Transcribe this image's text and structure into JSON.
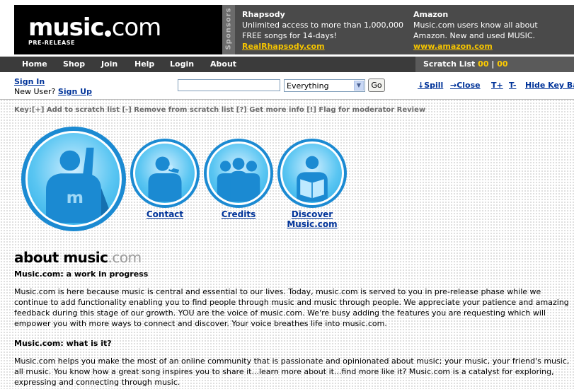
{
  "header": {
    "logo_word": "music",
    "logo_ext": "com",
    "logo_tag": "PRE-RELEASE",
    "sponsors_label": "Sponsors",
    "ads": [
      {
        "title": "Rhapsody",
        "text": "Unlimited access to more than 1,000,000 FREE songs for 14-days!",
        "link": "RealRhapsody.com"
      },
      {
        "title": "Amazon",
        "text": "Music.com users know all about Amazon. New and used MUSIC.",
        "link": "www.amazon.com"
      }
    ]
  },
  "nav": {
    "items": [
      "Home",
      "Shop",
      "Join",
      "Help",
      "Login",
      "About"
    ],
    "scratch_label": "Scratch List",
    "scratch_count_a": "00",
    "scratch_sep": "|",
    "scratch_count_b": "00"
  },
  "subbar": {
    "signin": "Sign In",
    "new_user": "New User?",
    "signup": "Sign Up",
    "search_value": "",
    "scope": "Everything",
    "go": "Go",
    "spill": "↓Spill",
    "close": "→Close",
    "tplus": "T+",
    "tminus": "T-",
    "hide_key": "Hide Key Bar"
  },
  "keybar": "Key:[+] Add to scratch list   [-] Remove from scratch list   [?] Get more info   [!] Flag for moderator Review",
  "icons": {
    "contact": "Contact",
    "credits": "Credits",
    "discover": "Discover Music.com"
  },
  "colors": {
    "accent": "#1b8ad2",
    "link": "#003399",
    "sponsor_link": "#f5c400",
    "nav_bg": "#3b3b3b"
  },
  "content": {
    "title_main": "about music",
    "title_ext": ".com",
    "s1_heading": "Music.com: a work in progress",
    "s1_body": "Music.com is here because music is central and essential to our lives. Today, music.com is served to you in pre-release phase while we continue to add functionality enabling you to find people through music and music through people. We appreciate your patience and amazing feedback during this stage of our growth. YOU are the voice of music.com. We're busy adding the features you are requesting which will empower you with more ways to connect and discover. Your voice breathes life into music.com.",
    "s2_heading": "Music.com: what is it?",
    "s2_body": "Music.com helps you make the most of an online community that is passionate and opinionated about music; your music, your friend's music, all music. You know how a great song inspires you to share it...learn more about it...find more like it? Music.com is a catalyst for exploring, expressing and connecting through music."
  }
}
